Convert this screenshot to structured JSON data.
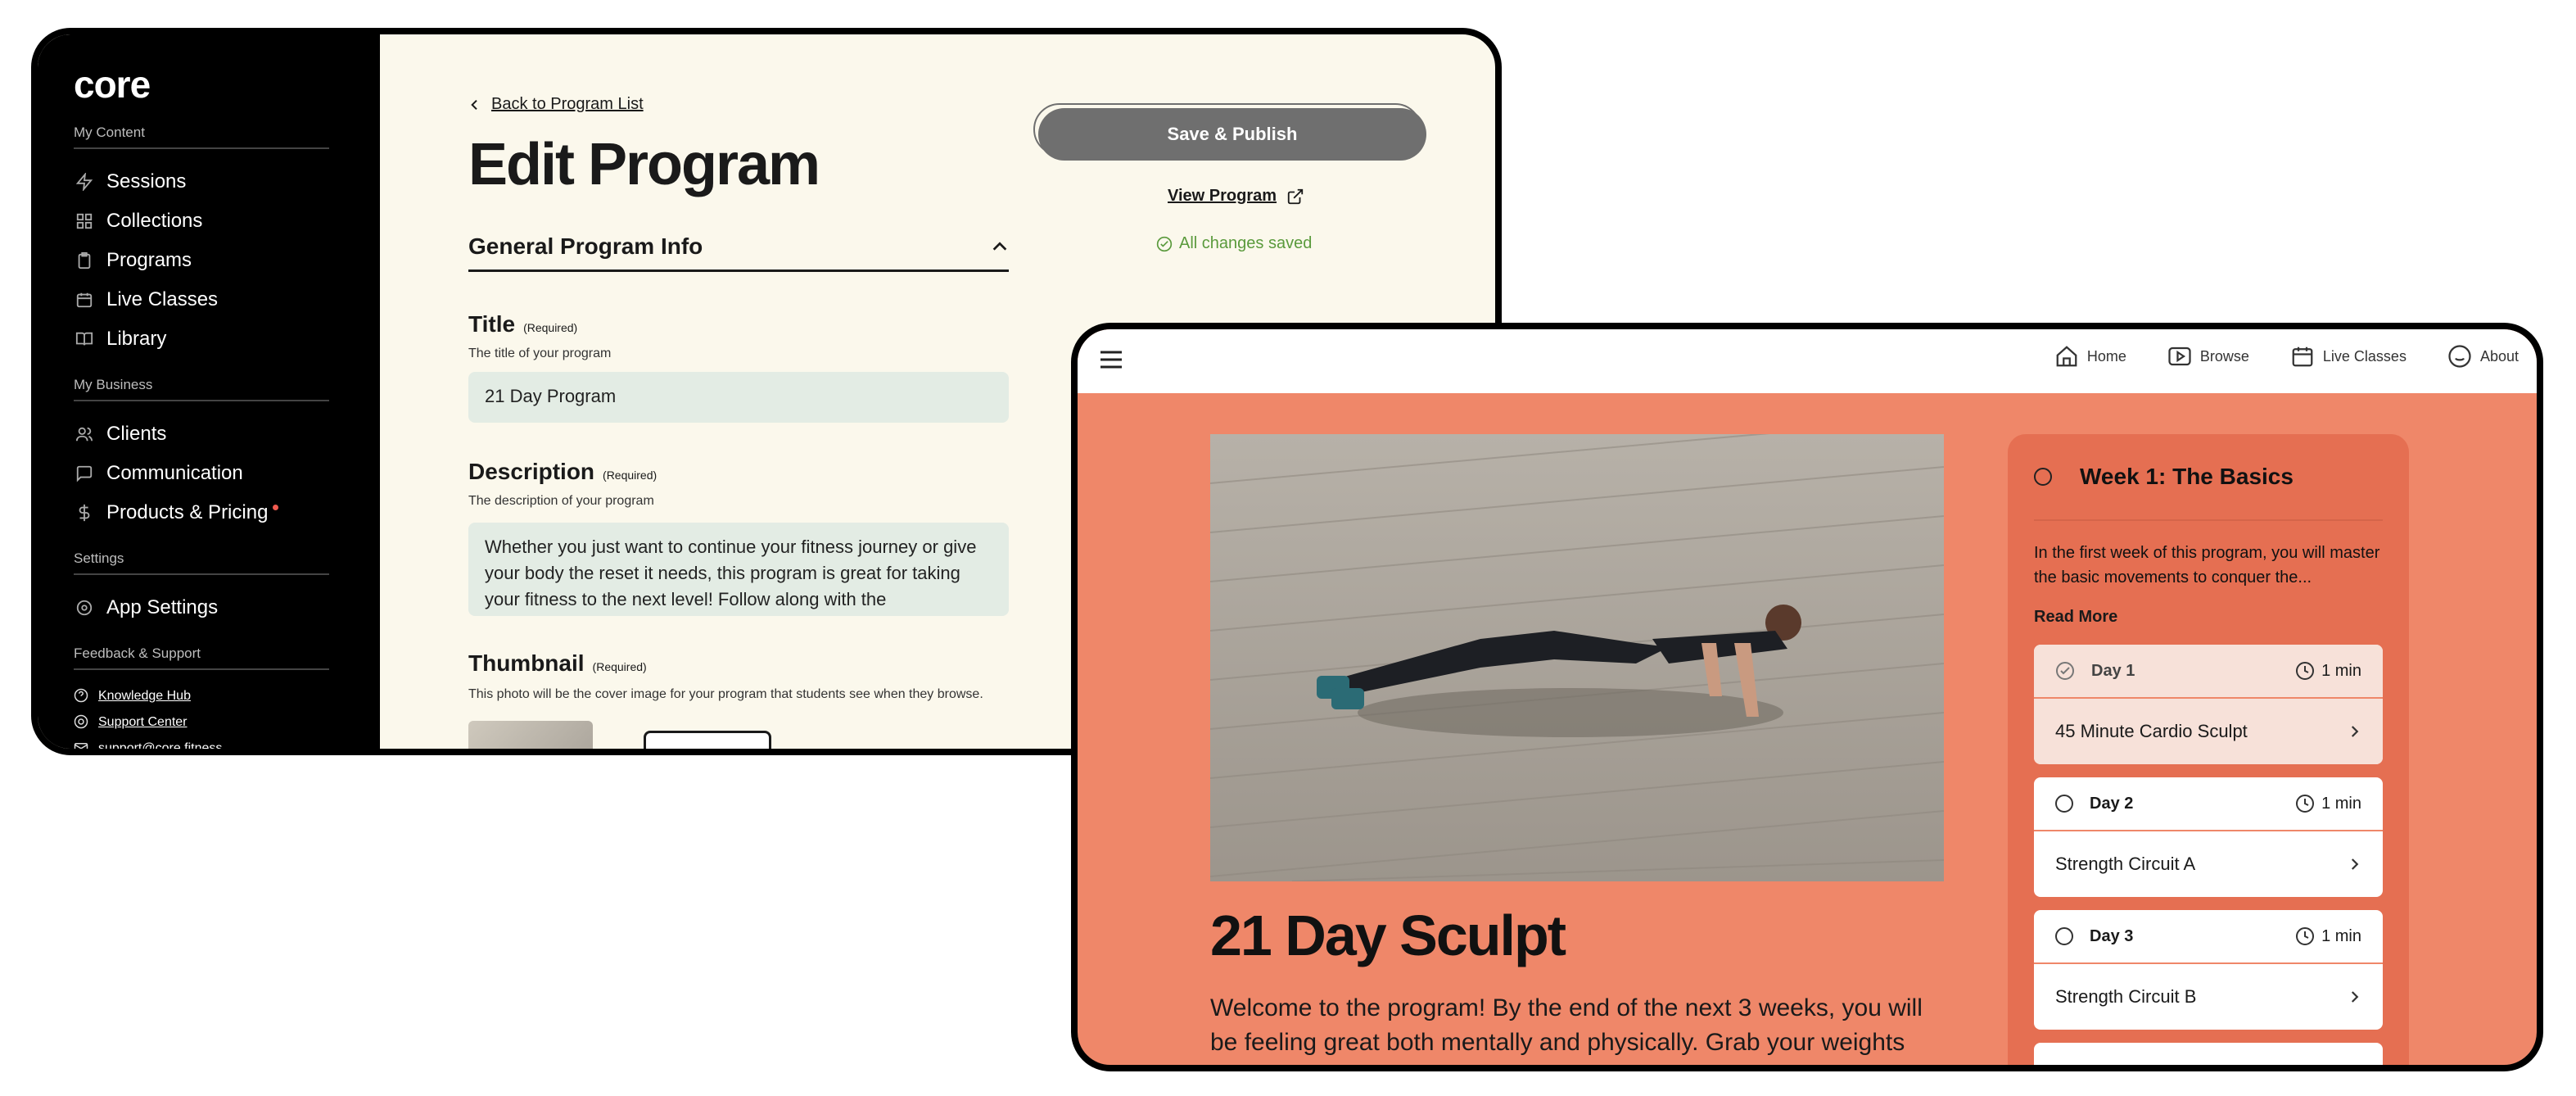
{
  "admin": {
    "logo": "core",
    "sections": {
      "my_content": "My Content",
      "my_business": "My Business",
      "settings": "Settings",
      "feedback": "Feedback & Support"
    },
    "content_items": [
      "Sessions",
      "Collections",
      "Programs",
      "Live Classes",
      "Library"
    ],
    "business_items": [
      "Clients",
      "Communication",
      "Products & Pricing"
    ],
    "settings_items": [
      "App Settings"
    ],
    "support_links": [
      "Knowledge Hub",
      "Support Center",
      "support@core.fitness"
    ],
    "back_link": "Back to Program List",
    "page_title": "Edit Program",
    "section_title": "General Program Info",
    "title_label": "Title",
    "required": "(Required)",
    "title_help": "The title of your program",
    "title_value": "21 Day Program",
    "desc_label": "Description",
    "desc_help": "The description of your program",
    "desc_value": "Whether you just want to continue your fitness journey or give your body the reset it needs, this program is great for taking your fitness to the next level! Follow along with the",
    "thumb_label": "Thumbnail",
    "thumb_help": "This photo will be the cover image for your program that students see when they browse.",
    "publish_label": "Save & Publish",
    "view_label": "View Program",
    "saved_label": "All changes saved"
  },
  "student": {
    "nav": [
      "Home",
      "Browse",
      "Live Classes",
      "About"
    ],
    "program_title": "21 Day Sculpt",
    "program_desc": "Welcome to the program! By the end of the next 3 weeks, you will be feeling great both mentally and physically. Grab your weights and lets",
    "week_title": "Week 1: The Basics",
    "week_desc": "In the first week of this program, you will master the basic movements to conquer the...",
    "read_more": "Read More",
    "days": [
      {
        "day": "Day 1",
        "duration": "1 min",
        "session": "45 Minute Cardio Sculpt"
      },
      {
        "day": "Day 2",
        "duration": "1 min",
        "session": "Strength Circuit A"
      },
      {
        "day": "Day 3",
        "duration": "1 min",
        "session": "Strength Circuit B"
      }
    ]
  },
  "colors": {
    "sidebar": "#000000",
    "editor_bg": "#fbf8ec",
    "input_bg": "#e3ece4",
    "publish": "#6f6f6f",
    "saved_green": "#5a9a3c",
    "student_bg": "#ef8769",
    "week_panel": "#e56f52",
    "notify_dot": "#f05a4f"
  },
  "icons": [
    "lightning-icon",
    "grid-icon",
    "clipboard-icon",
    "calendar-icon",
    "book-icon",
    "users-icon",
    "chat-icon",
    "dollar-icon",
    "gear-icon",
    "question-icon",
    "lifebuoy-icon",
    "mail-icon",
    "chevron-left-icon",
    "chevron-up-icon",
    "external-link-icon",
    "check-circle-icon",
    "hamburger-icon",
    "home-icon",
    "play-icon",
    "smile-icon",
    "clock-icon",
    "chevron-right-icon"
  ]
}
